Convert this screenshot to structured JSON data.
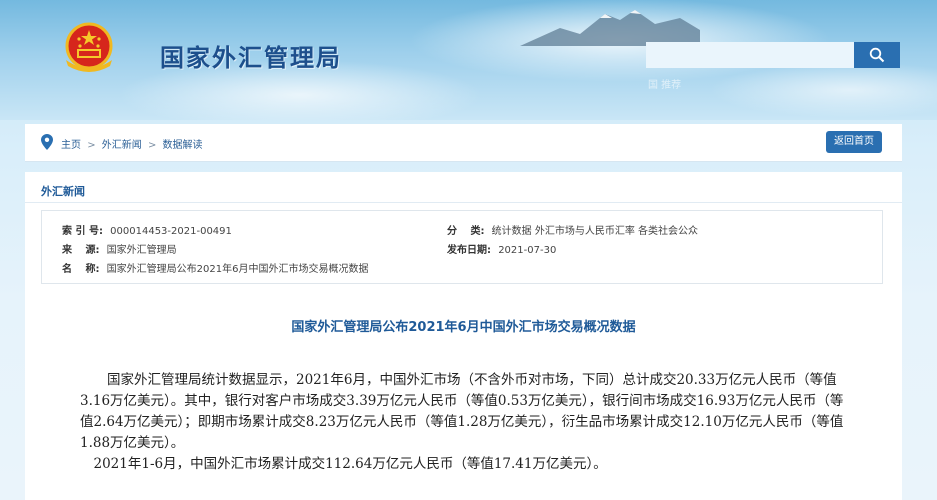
{
  "header": {
    "site_title": "国家外汇管理局",
    "search_placeholder": "",
    "search_icon": "search-icon",
    "faint_text": "国 推荐"
  },
  "breadcrumb": {
    "items": [
      "主页",
      "外汇新闻",
      "数据解读"
    ],
    "separator": ">",
    "back_home": "返回首页"
  },
  "section": {
    "heading": "外汇新闻"
  },
  "meta": {
    "index_label": "索 引 号:",
    "index_value": "000014453-2021-00491",
    "source_label": "来　 源:",
    "source_value": "国家外汇管理局",
    "name_label": "名　 称:",
    "name_value": "国家外汇管理局公布2021年6月中国外汇市场交易概况数据",
    "category_label": "分　 类:",
    "category_value": "统计数据  外汇市场与人民币汇率  各类社会公众",
    "date_label": "发布日期:",
    "date_value": "2021-07-30"
  },
  "article": {
    "title": "国家外汇管理局公布2021年6月中国外汇市场交易概况数据",
    "paragraph1": "国家外汇管理局统计数据显示，2021年6月，中国外汇市场（不含外币对市场，下同）总计成交20.33万亿元人民币（等值3.16万亿美元）。其中，银行对客户市场成交3.39万亿元人民币（等值0.53万亿美元），银行间市场成交16.93万亿元人民币（等值2.64万亿美元）；即期市场累计成交8.23万亿元人民币（等值1.28万亿美元），衍生品市场累计成交12.10万亿元人民币（等值1.88万亿美元）。",
    "paragraph2": "2021年1-6月，中国外汇市场累计成交112.64万亿元人民币（等值17.41万亿美元）。"
  },
  "colors": {
    "brand_blue": "#1d4f8c",
    "link_blue": "#2b5f96",
    "button_blue": "#2a6fb1"
  }
}
